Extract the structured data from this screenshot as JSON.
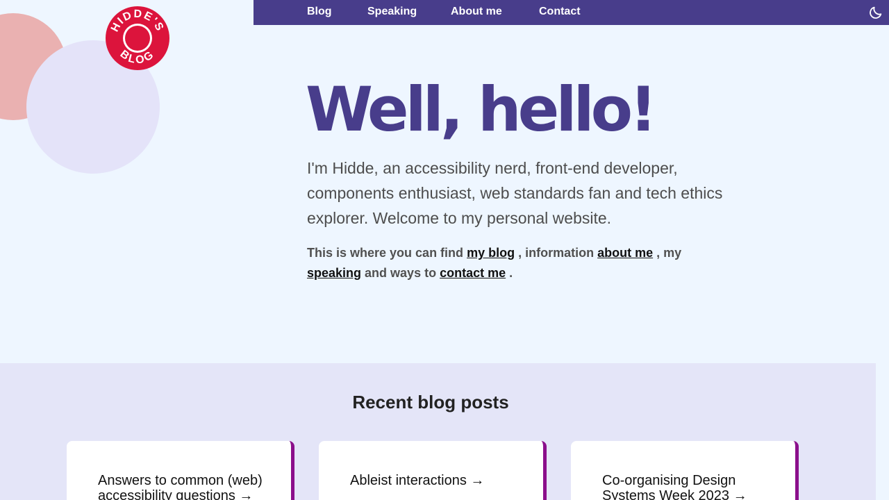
{
  "logo": {
    "text": "HIDDE'S BLOG"
  },
  "nav": {
    "items": [
      {
        "label": "Blog"
      },
      {
        "label": "Speaking"
      },
      {
        "label": "About me"
      },
      {
        "label": "Contact"
      }
    ]
  },
  "hero": {
    "title": "Well, hello!",
    "intro": "I'm Hidde, an accessibility nerd, front-end developer, components enthusiast, web standards fan and tech ethics explorer. Welcome to my personal website.",
    "links": {
      "prefix": "This is where you can find",
      "blog": "my blog",
      "sep1": ", information",
      "about": "about me",
      "sep2": ", my",
      "speaking": "speaking",
      "sep3": "and ways to",
      "contact": "contact me",
      "end": "."
    }
  },
  "recent": {
    "title": "Recent blog posts",
    "posts": [
      {
        "title": "Answers to common (web) accessibility questions →"
      },
      {
        "title": "Ableist interactions →"
      },
      {
        "title": "Co-organising Design Systems Week 2023 →"
      }
    ]
  },
  "colors": {
    "brand": "#483d8b",
    "logo_red": "#dc143c",
    "card_accent": "#8b0f8b",
    "background": "#eef6ff",
    "section_bg": "#e4e5f8"
  },
  "icons": {
    "theme_toggle": "moon-icon",
    "logo": "logo-badge"
  }
}
